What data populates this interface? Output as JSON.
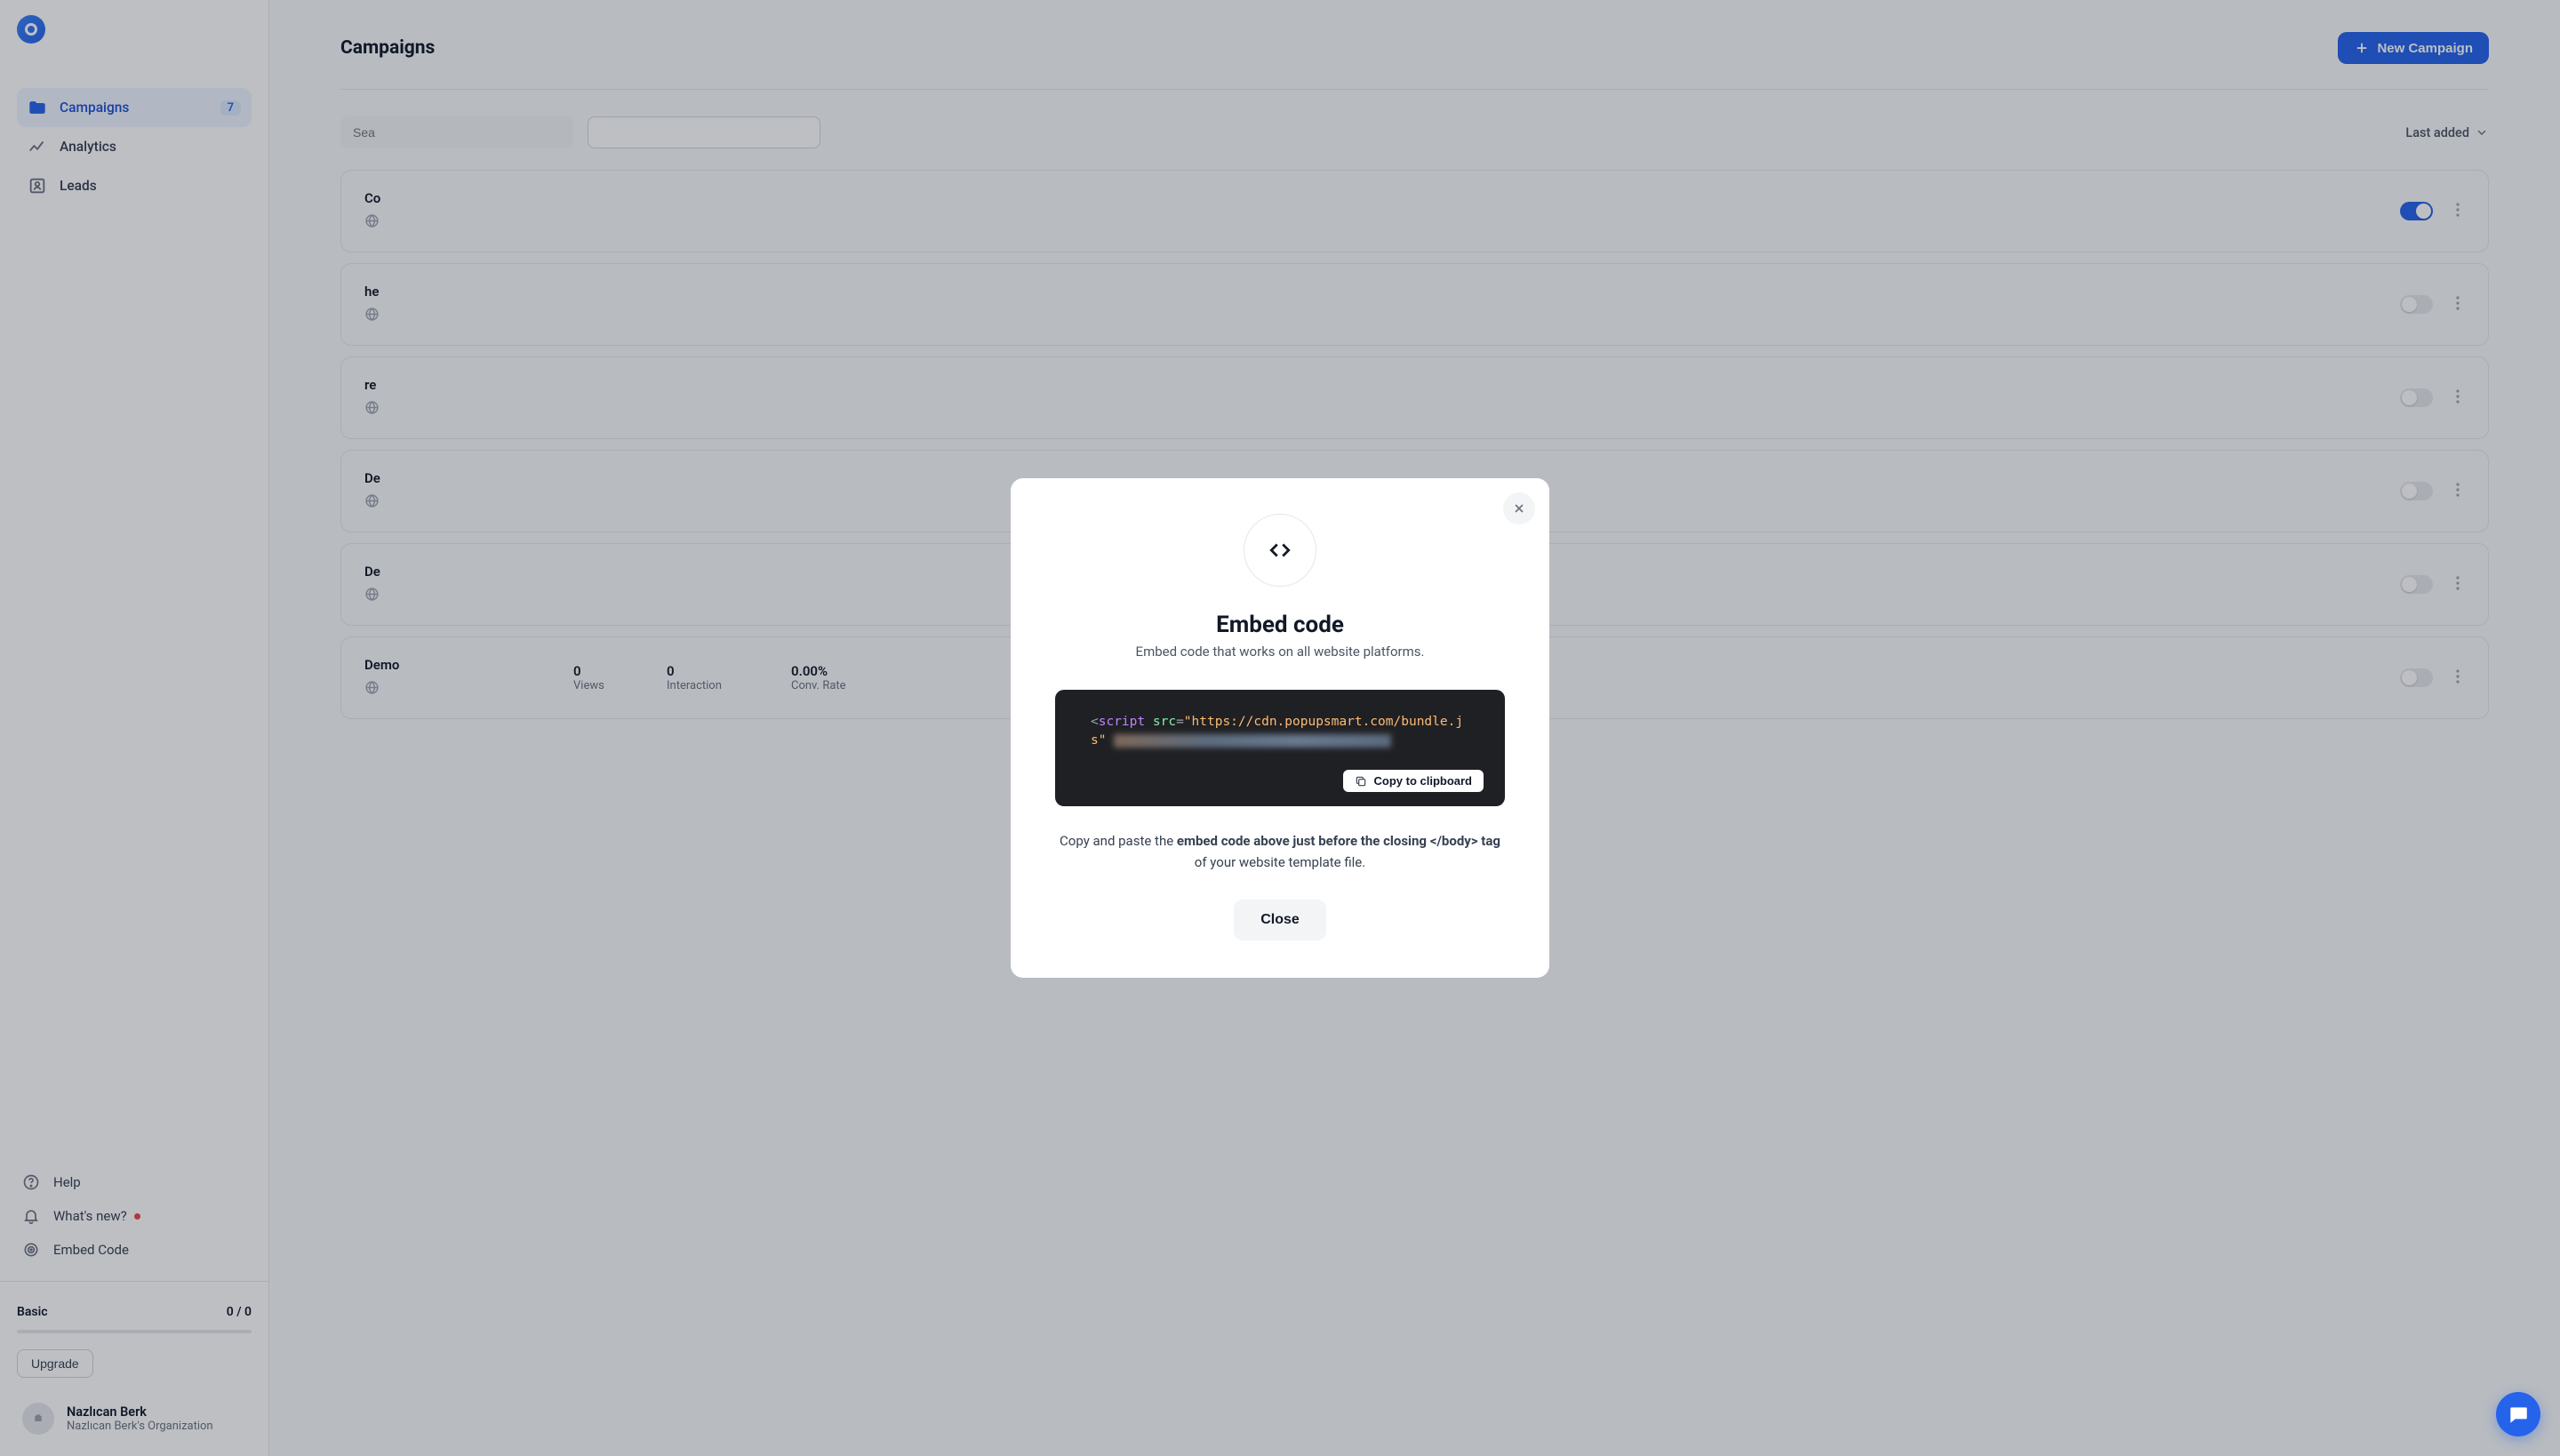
{
  "sidebar": {
    "nav": [
      {
        "label": "Campaigns",
        "badge": "7",
        "active": true,
        "icon": "folder"
      },
      {
        "label": "Analytics",
        "icon": "chart"
      },
      {
        "label": "Leads",
        "icon": "leads"
      }
    ],
    "lower": [
      {
        "label": "Help",
        "icon": "help"
      },
      {
        "label": "What's new?",
        "icon": "bell",
        "dot": true
      },
      {
        "label": "Embed Code",
        "icon": "target"
      }
    ],
    "plan": {
      "name": "Basic",
      "usage": "0 / 0",
      "upgrade_label": "Upgrade"
    },
    "user": {
      "name": "Nazlıcan Berk",
      "org": "Nazlıcan Berk's Organization"
    }
  },
  "main": {
    "title": "Campaigns",
    "new_button": "New Campaign",
    "search_placeholder": "Sea",
    "sort_label": "Last added",
    "stats_labels": {
      "views": "Views",
      "interaction": "Interaction",
      "conv": "Conv. Rate"
    },
    "campaigns": [
      {
        "title": "Co",
        "views": "",
        "interaction": "",
        "conv": "",
        "on": true
      },
      {
        "title": "he",
        "views": "",
        "interaction": "",
        "conv": "",
        "on": false
      },
      {
        "title": "re",
        "views": "",
        "interaction": "",
        "conv": "",
        "on": false
      },
      {
        "title": "De",
        "views": "",
        "interaction": "",
        "conv": "",
        "on": false
      },
      {
        "title": "De",
        "views": "",
        "interaction": "",
        "conv": "",
        "on": false
      },
      {
        "title": "Demo",
        "views": "0",
        "interaction": "0",
        "conv": "0.00%",
        "on": false
      }
    ]
  },
  "modal": {
    "title": "Embed code",
    "subtitle": "Embed code that works on all website platforms.",
    "code_prefix": "<",
    "code_tag": "script",
    "code_attr": "src",
    "code_eq": "=",
    "code_url_open": "\"https://cdn.popupsmart.com/bundle.j",
    "code_url_close_line": "s\"",
    "copy_label": "Copy to clipboard",
    "instr_pre": "Copy and paste the ",
    "instr_bold": "embed code above just before the closing </body> tag",
    "instr_post": " of your website template file.",
    "close_label": "Close"
  }
}
